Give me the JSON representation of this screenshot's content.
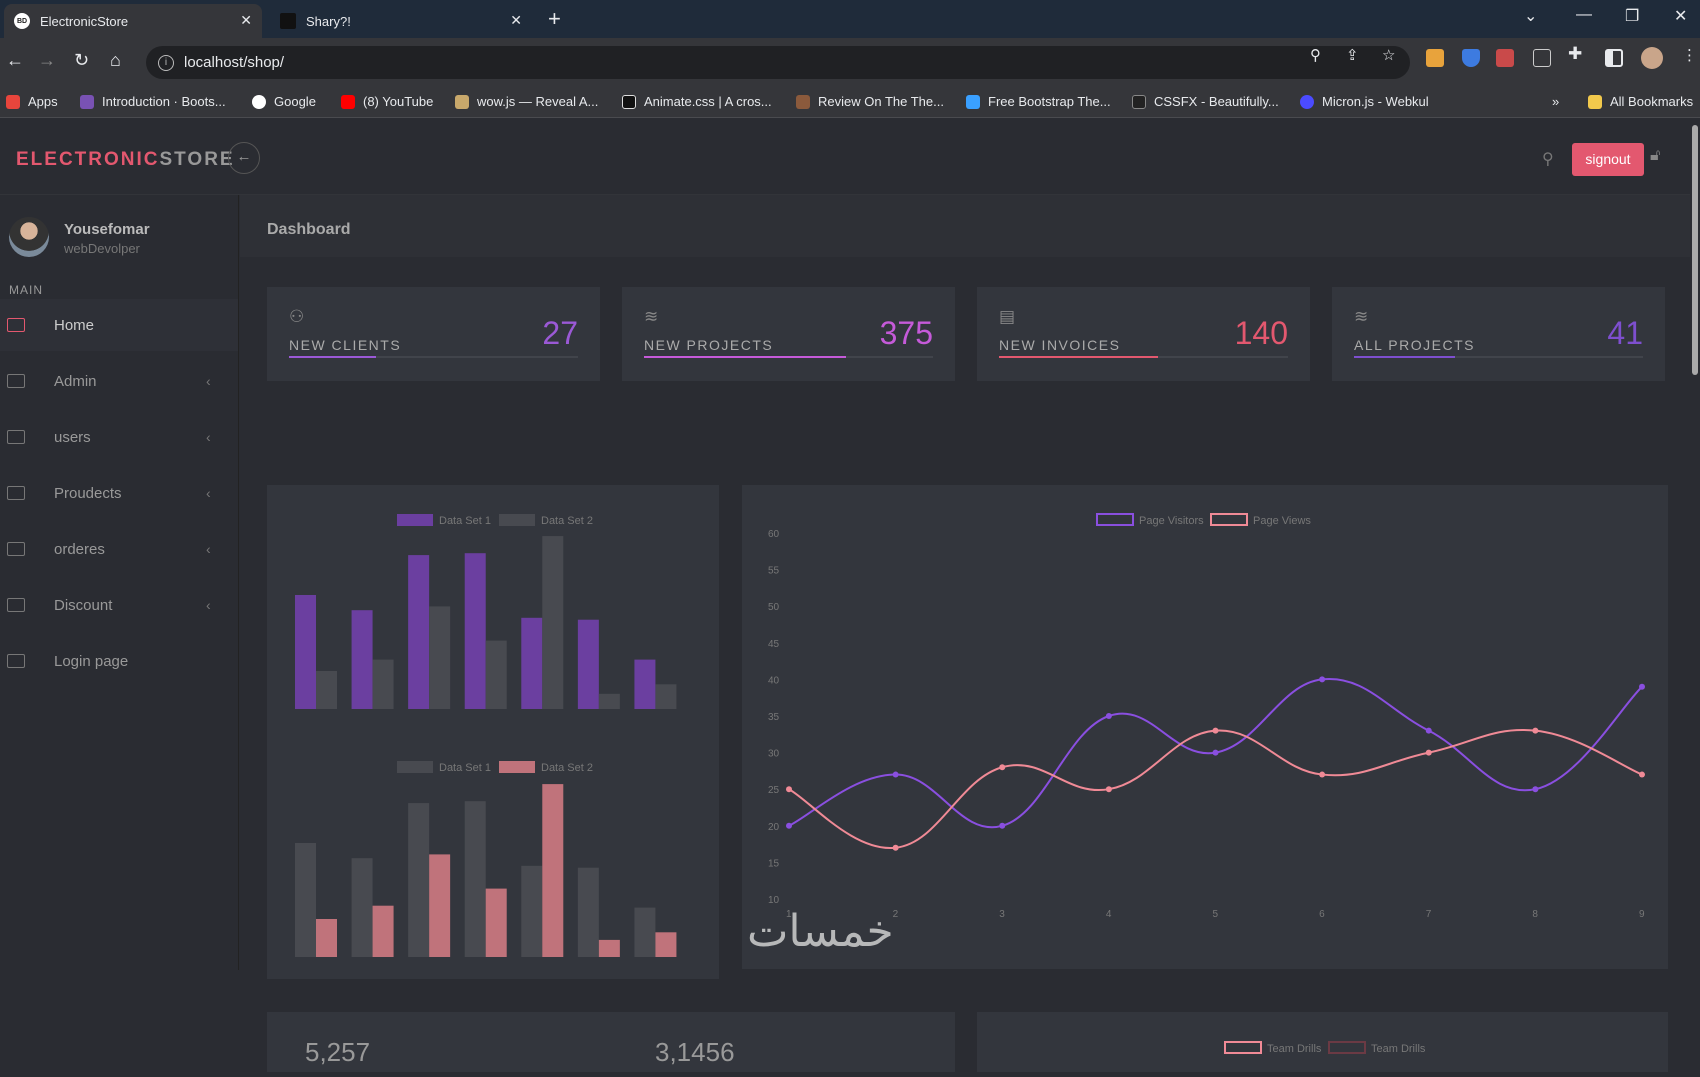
{
  "browser": {
    "tabs": [
      {
        "title": "ElectronicStore",
        "favicon": "BD",
        "active": true
      },
      {
        "title": "Shary?!",
        "active": false
      }
    ],
    "url": "localhost/shop/",
    "bookmarks": [
      {
        "label": "Apps",
        "color": "#e8453c"
      },
      {
        "label": "Introduction · Boots...",
        "color": "#7952b3"
      },
      {
        "label": "Google",
        "color": "#ffffff"
      },
      {
        "label": "(8) YouTube",
        "color": "#ff0000"
      },
      {
        "label": "wow.js — Reveal A...",
        "color": "#c8a86b"
      },
      {
        "label": "Animate.css | A cros...",
        "color": "#111111"
      },
      {
        "label": "Review On The The...",
        "color": "#8b5a3c"
      },
      {
        "label": "Free Bootstrap The...",
        "color": "#3aa0ff"
      },
      {
        "label": "CSSFX - Beautifully...",
        "color": "#222222"
      },
      {
        "label": "Micron.js - Webkul",
        "color": "#4b4bff"
      }
    ],
    "all_bookmarks": "All Bookmarks",
    "overflow": "»"
  },
  "app": {
    "brand_part1": "ELECTRONIC",
    "brand_part2": "STORE",
    "signout": "signout",
    "user": {
      "name": "Yousefomar",
      "role": "webDevolper"
    },
    "section_label": "MAIN",
    "nav": [
      {
        "label": "Home",
        "active": true,
        "chevron": false
      },
      {
        "label": "Admin",
        "active": false,
        "chevron": true
      },
      {
        "label": "users",
        "active": false,
        "chevron": true
      },
      {
        "label": "Proudects",
        "active": false,
        "chevron": true
      },
      {
        "label": "orderes",
        "active": false,
        "chevron": true
      },
      {
        "label": "Discount",
        "active": false,
        "chevron": true
      },
      {
        "label": "Login page",
        "active": false,
        "chevron": false
      }
    ],
    "page_title": "Dashboard"
  },
  "stats": [
    {
      "label": "NEW CLIENTS",
      "value": "27",
      "color": "#9b59d6",
      "progress": 0.3,
      "icon": "user-icon"
    },
    {
      "label": "NEW PROJECTS",
      "value": "375",
      "color": "#c55ad9",
      "progress": 0.7,
      "icon": "layers-icon"
    },
    {
      "label": "NEW INVOICES",
      "value": "140",
      "color": "#e3586f",
      "progress": 0.55,
      "icon": "clipboard-icon"
    },
    {
      "label": "ALL PROJECTS",
      "value": "41",
      "color": "#7e4fcf",
      "progress": 0.35,
      "icon": "layers-icon"
    }
  ],
  "partial_values": [
    "5,257",
    "3,1456"
  ],
  "chart_data": [
    {
      "type": "bar",
      "categories": [
        "",
        "",
        "",
        "",
        "",
        "",
        ""
      ],
      "series": [
        {
          "name": "Data Set 1",
          "values": [
            60,
            52,
            81,
            82,
            48,
            47,
            26
          ],
          "color": "#6b3fa0"
        },
        {
          "name": "Data Set 2",
          "values": [
            20,
            26,
            54,
            36,
            91,
            8,
            13
          ],
          "color": "#484a50"
        }
      ],
      "ylim": [
        0,
        100
      ],
      "legend": "top-center"
    },
    {
      "type": "bar",
      "categories": [
        "",
        "",
        "",
        "",
        "",
        "",
        ""
      ],
      "series": [
        {
          "name": "Data Set 1",
          "values": [
            60,
            52,
            81,
            82,
            48,
            47,
            26
          ],
          "color": "#484a50"
        },
        {
          "name": "Data Set 2",
          "values": [
            20,
            27,
            54,
            36,
            91,
            9,
            13
          ],
          "color": "#c0737b"
        }
      ],
      "ylim": [
        0,
        100
      ],
      "legend": "top-center"
    },
    {
      "type": "line",
      "x": [
        1,
        2,
        3,
        4,
        5,
        6,
        7,
        8,
        9
      ],
      "series": [
        {
          "name": "Page Visitors",
          "values": [
            20,
            27,
            20,
            35,
            30,
            40,
            33,
            25,
            39
          ],
          "color": "#8a4fe0"
        },
        {
          "name": "Page Views",
          "values": [
            25,
            17,
            28,
            25,
            33,
            27,
            30,
            33,
            27
          ],
          "color": "#f08a96"
        }
      ],
      "yticks": [
        10,
        15,
        20,
        25,
        30,
        35,
        40,
        45,
        50,
        55,
        60
      ],
      "ylim": [
        10,
        60
      ],
      "legend": "top-center",
      "grid": false
    },
    {
      "type": "line",
      "series": [
        {
          "name": "Team Drills",
          "color": "#f08a96"
        },
        {
          "name": "Team Drills",
          "color": "#6b3a44"
        }
      ],
      "legend": "top-center"
    }
  ],
  "watermark": "خمسات"
}
